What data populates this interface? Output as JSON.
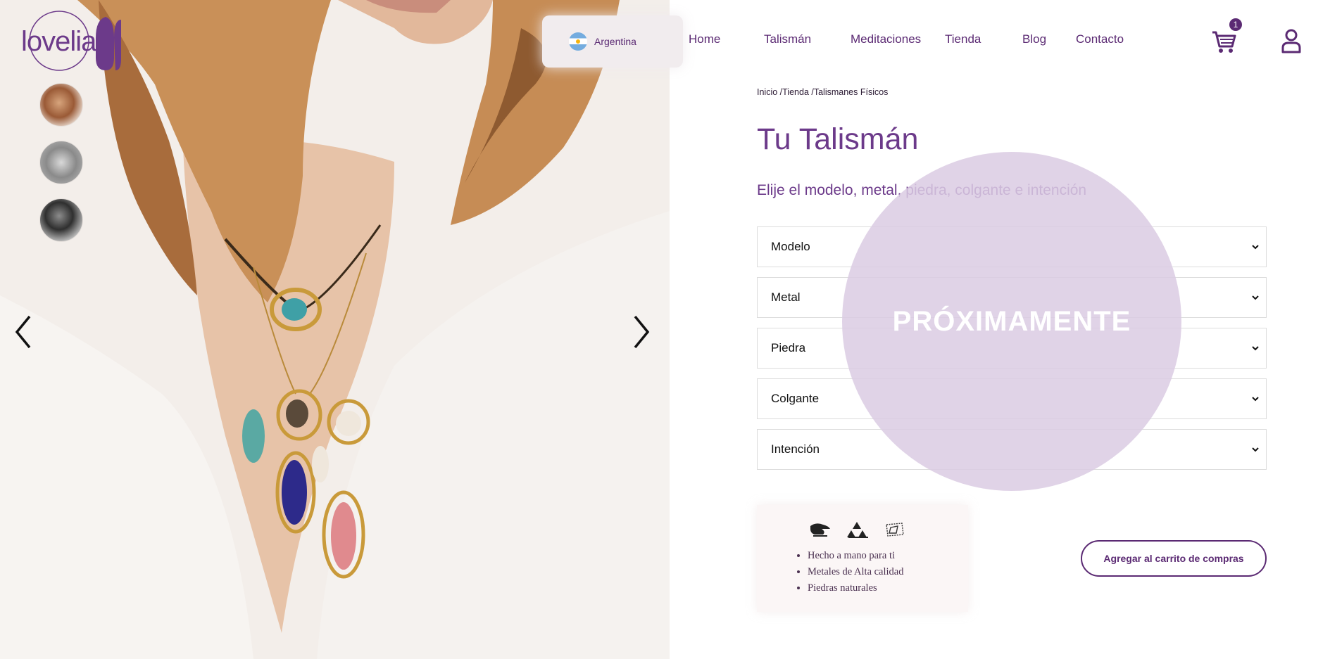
{
  "brand": {
    "logo_text": "lovelia",
    "accent": "#5b2a73",
    "light_accent": "#dbcbe3"
  },
  "header": {
    "country": "Argentina",
    "nav": [
      "Home",
      "Talismán",
      "Meditaciones",
      "Tienda",
      "Blog",
      "Contacto"
    ],
    "cart_count": "1",
    "icons": {
      "cart": "cart-icon",
      "user": "user-icon",
      "flag": "argentina-flag-icon"
    }
  },
  "gallery": {
    "thumbnails": [
      "thumbnail-1",
      "thumbnail-2",
      "thumbnail-3"
    ],
    "prev": "chevron-left-icon",
    "next": "chevron-right-icon"
  },
  "breadcrumb": {
    "items": [
      "Inicio /",
      "Tienda /",
      "Talismanes Físicos"
    ]
  },
  "product": {
    "title": "Tu Talismán",
    "subtitle": "Elije el modelo, metal, piedra, colgante e intención",
    "selects": [
      "Modelo",
      "Metal",
      "Piedra",
      "Colgante",
      "Intención"
    ],
    "overlay": "PRÓXIMAMENTE"
  },
  "features": {
    "icons": [
      "handmade-icon",
      "metal-bars-icon",
      "gemstone-icon"
    ],
    "items": [
      "Hecho a mano para ti",
      "Metales de Alta calidad",
      "Piedras naturales"
    ]
  },
  "cta": {
    "add_to_cart": "Agregar al carrito de compras"
  }
}
